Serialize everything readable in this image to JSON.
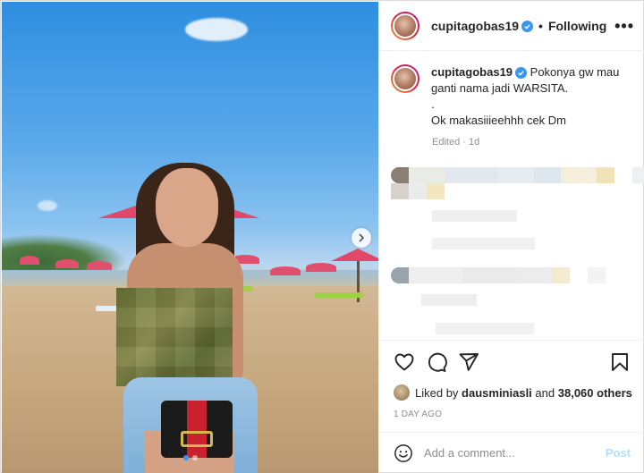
{
  "post": {
    "username": "cupitagobas19",
    "follow_sep": "•",
    "follow_status": "Following",
    "more_label": "•••"
  },
  "caption": {
    "username": "cupitagobas19",
    "line1": "Pokonya gw mau ganti nama jadi WARSITA.",
    "line2": ".",
    "line3": "Ok makasiiieehhh cek Dm",
    "meta": "Edited · 1d"
  },
  "likes": {
    "prefix": "Liked by",
    "user": "dausminiasli",
    "and": "and",
    "count": "38,060 others"
  },
  "date": "1 DAY AGO",
  "comment": {
    "placeholder": "Add a comment...",
    "post_label": "Post"
  },
  "colors": {
    "accent": "#3897f0",
    "post_disabled": "#b2dffc",
    "secondary_text": "#8e8e8e"
  },
  "icons": [
    "verified-badge-icon",
    "more-options-icon",
    "heart-icon",
    "comment-icon",
    "share-icon",
    "bookmark-icon",
    "emoji-icon",
    "chevron-right-icon"
  ]
}
